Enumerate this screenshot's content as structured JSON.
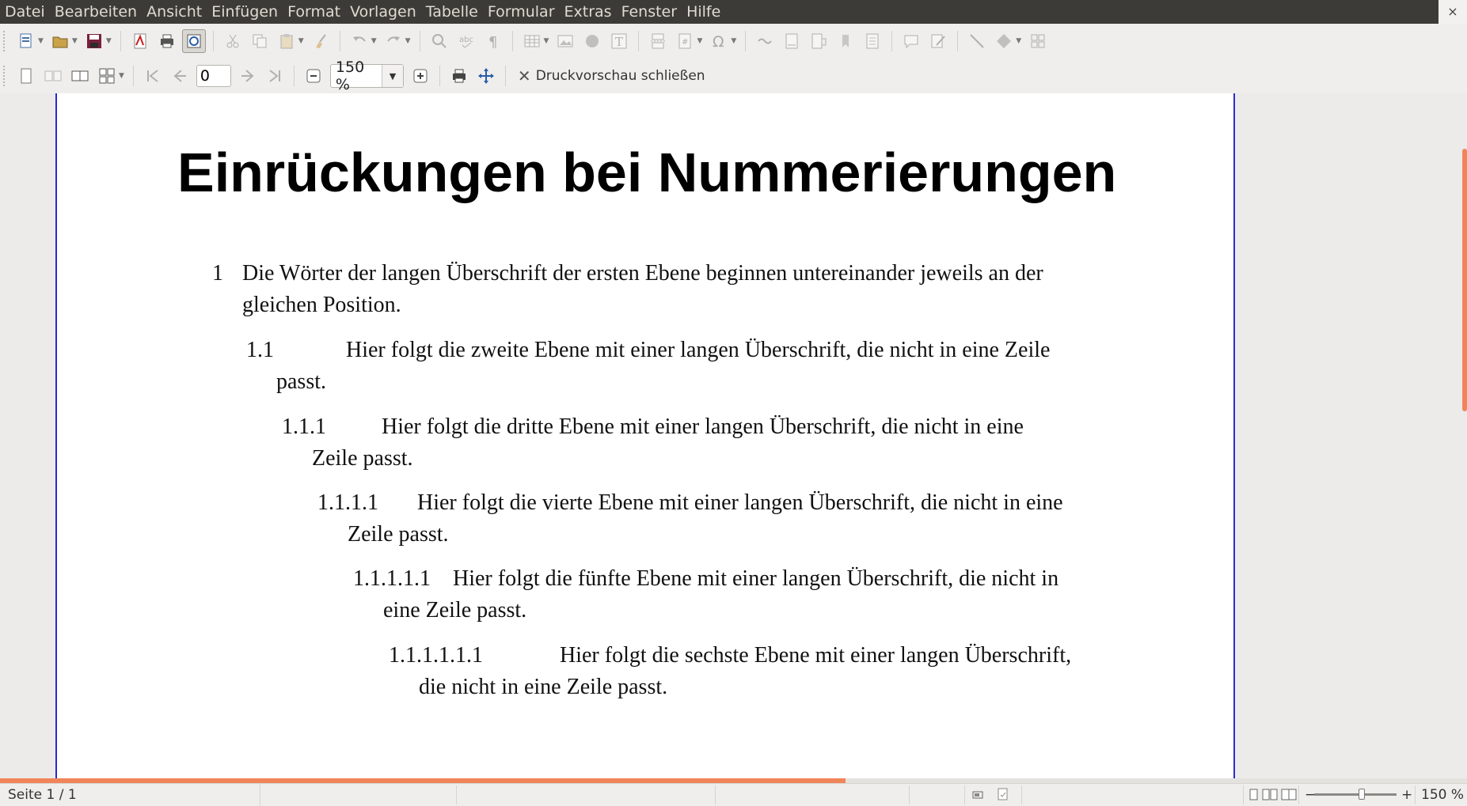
{
  "menu": [
    "Datei",
    "Bearbeiten",
    "Ansicht",
    "Einfügen",
    "Format",
    "Vorlagen",
    "Tabelle",
    "Formular",
    "Extras",
    "Fenster",
    "Hilfe"
  ],
  "window": {
    "close_glyph": "×"
  },
  "preview_toolbar": {
    "page_value": "0",
    "zoom_value": "150 %",
    "close_preview_label": "Druckvorschau schließen"
  },
  "document": {
    "title": "Einrückungen bei Nummerierungen",
    "headings": [
      {
        "number": "1",
        "line1": "Die Wörter der langen Überschrift der ersten Ebene beginnen untereinander jeweils an der",
        "line2": "gleichen Position."
      },
      {
        "number": "1.1",
        "line1": "Hier folgt die zweite Ebene mit einer langen Überschrift, die nicht in eine Zeile",
        "line2": "passt."
      },
      {
        "number": "1.1.1",
        "line1": "Hier folgt die dritte Ebene mit einer langen Überschrift, die nicht in eine",
        "line2": "Zeile passt."
      },
      {
        "number": "1.1.1.1",
        "line1": "Hier folgt die vierte Ebene mit einer langen Überschrift, die nicht in eine",
        "line2": "Zeile passt."
      },
      {
        "number": "1.1.1.1.1",
        "line1": "Hier folgt die fünfte Ebene mit einer langen Überschrift, die nicht in",
        "line2": "eine Zeile passt."
      },
      {
        "number": "1.1.1.1.1.1",
        "line1": "Hier folgt die sechste Ebene mit einer langen Überschrift,",
        "line2": "die nicht in eine Zeile passt."
      }
    ]
  },
  "status": {
    "page": "Seite 1 / 1",
    "zoom_minus": "−",
    "zoom_plus": "+",
    "zoom": "150 %"
  },
  "colors": {
    "accent": "#f0855a",
    "page_border": "#2a2ad0",
    "menubar": "#3c3b37"
  }
}
